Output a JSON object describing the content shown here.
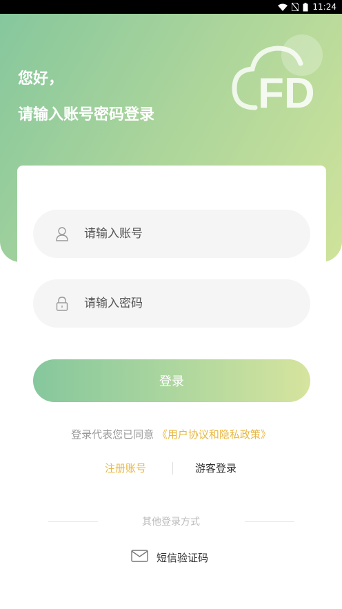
{
  "status_bar": {
    "time": "11:24",
    "battery": "1"
  },
  "header": {
    "greeting_line1": "您好，",
    "greeting_line2": "请输入账号密码登录",
    "logo_text": "FD"
  },
  "form": {
    "account_placeholder": "请输入账号",
    "password_placeholder": "请输入密码",
    "login_label": "登录"
  },
  "agreement": {
    "prefix": "登录代表您已同意",
    "policy_link": "《用户协议和隐私政策》"
  },
  "links": {
    "register": "注册账号",
    "guest_login": "游客登录"
  },
  "other_login": {
    "label": "其他登录方式",
    "sms_label": "短信验证码"
  },
  "colors": {
    "gradient_start": "#86c79d",
    "gradient_end": "#d6e49e",
    "accent": "#e8b73f"
  }
}
